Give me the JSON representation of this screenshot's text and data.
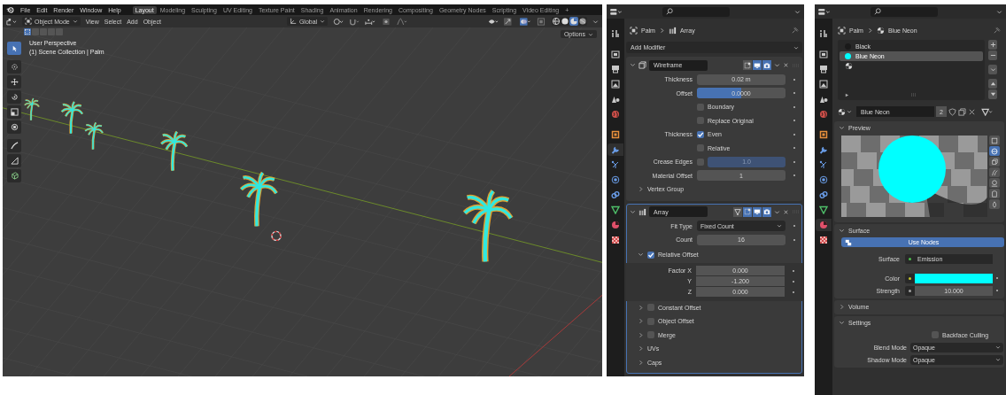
{
  "viewport": {
    "menu": [
      "File",
      "Edit",
      "Render",
      "Window",
      "Help"
    ],
    "workspaces": [
      {
        "label": "Layout",
        "selected": true
      },
      {
        "label": "Modeling",
        "selected": false
      },
      {
        "label": "Sculpting",
        "selected": false
      },
      {
        "label": "UV Editing",
        "selected": false
      },
      {
        "label": "Texture Paint",
        "selected": false
      },
      {
        "label": "Shading",
        "selected": false
      },
      {
        "label": "Animation",
        "selected": false
      },
      {
        "label": "Rendering",
        "selected": false
      },
      {
        "label": "Compositing",
        "selected": false
      },
      {
        "label": "Geometry Nodes",
        "selected": false
      },
      {
        "label": "Scripting",
        "selected": false
      },
      {
        "label": "Video Editing",
        "selected": false
      }
    ],
    "add_workspace": "+",
    "mode": "Object Mode",
    "header_menu": [
      "View",
      "Select",
      "Add",
      "Object"
    ],
    "orientation": "Global",
    "shading_modes": [
      {
        "kind": "wireframe",
        "selected": false
      },
      {
        "kind": "solid",
        "selected": false
      },
      {
        "kind": "material",
        "selected": true
      },
      {
        "kind": "rendered",
        "selected": false
      }
    ],
    "options": "Options",
    "overlay_text": [
      "User Perspective",
      "(1) Scene Collection | Palm"
    ],
    "tools": [
      {
        "selected": true
      },
      {
        "selected": false
      },
      {
        "selected": false
      },
      {
        "selected": false
      },
      {
        "selected": false
      },
      {
        "selected": false
      },
      {
        "selected": false
      },
      {
        "selected": false
      },
      {
        "selected": false
      }
    ]
  },
  "modifier_properties": {
    "tabs": [
      {
        "kind": "tool",
        "selected": false
      },
      {
        "kind": "render",
        "selected": false
      },
      {
        "kind": "output",
        "selected": false
      },
      {
        "kind": "view_layer",
        "selected": false
      },
      {
        "kind": "scene",
        "selected": false
      },
      {
        "kind": "world",
        "selected": false
      },
      {
        "kind": "object",
        "selected": false
      },
      {
        "kind": "modifiers",
        "selected": true
      },
      {
        "kind": "particles",
        "selected": false
      },
      {
        "kind": "physics",
        "selected": false
      },
      {
        "kind": "constraints",
        "selected": false
      },
      {
        "kind": "data",
        "selected": false
      },
      {
        "kind": "material",
        "selected": false
      },
      {
        "kind": "texture",
        "selected": false
      }
    ],
    "breadcrumb": [
      "Palm",
      "Array"
    ],
    "add_modifier": "Add Modifier",
    "modifiers": [
      {
        "kind": "wireframe",
        "name": "Wireframe",
        "expanded": true,
        "selected": false,
        "toggles": [
          {
            "kind": "edit_mode",
            "on": false
          },
          {
            "kind": "realtime",
            "on": true
          },
          {
            "kind": "render",
            "on": true
          }
        ],
        "rows": [
          {
            "kind": "field",
            "label": "Thickness",
            "value": "0.02 m"
          },
          {
            "kind": "slider",
            "label": "Offset",
            "value": "0.0000",
            "level": 0.5
          },
          {
            "kind": "check",
            "text": "Boundary",
            "checked": false
          },
          {
            "kind": "check",
            "text": "Replace Original",
            "checked": false
          },
          {
            "kind": "check",
            "label": "Thickness",
            "text": "Even",
            "checked": true
          },
          {
            "kind": "check",
            "text": "Relative",
            "checked": false
          },
          {
            "kind": "check_field",
            "label": "Crease Edges",
            "checked": false,
            "value": "1.0"
          },
          {
            "kind": "field",
            "label": "Material Offset",
            "value": "1"
          },
          {
            "kind": "subpanel",
            "text": "Vertex Group",
            "expanded": false
          }
        ]
      },
      {
        "kind": "array",
        "name": "Array",
        "expanded": true,
        "selected": true,
        "toggles": [
          {
            "kind": "on_cage",
            "on": false
          },
          {
            "kind": "edit_mode",
            "on": true
          },
          {
            "kind": "realtime",
            "on": true
          },
          {
            "kind": "render",
            "on": true
          }
        ],
        "rows": [
          {
            "kind": "dropdown",
            "label": "Fit Type",
            "value": "Fixed Count"
          },
          {
            "kind": "field",
            "label": "Count",
            "value": "16"
          },
          {
            "kind": "subpanel",
            "text": "Relative Offset",
            "expanded": true,
            "checked": true,
            "rows": [
              {
                "kind": "field",
                "label": "Factor X",
                "value": "0.000"
              },
              {
                "kind": "field",
                "label": "Y",
                "value": "-1.200"
              },
              {
                "kind": "field",
                "label": "Z",
                "value": "0.000"
              }
            ]
          },
          {
            "kind": "subpanel",
            "text": "Constant Offset",
            "expanded": false,
            "checked": false
          },
          {
            "kind": "subpanel",
            "text": "Object Offset",
            "expanded": false,
            "checked": false
          },
          {
            "kind": "subpanel",
            "text": "Merge",
            "expanded": false,
            "checked": false
          },
          {
            "kind": "subpanel",
            "text": "UVs",
            "expanded": false
          },
          {
            "kind": "subpanel",
            "text": "Caps",
            "expanded": false
          }
        ]
      }
    ]
  },
  "material_properties": {
    "tabs": [
      {
        "kind": "tool",
        "selected": false
      },
      {
        "kind": "render",
        "selected": false
      },
      {
        "kind": "output",
        "selected": false
      },
      {
        "kind": "view_layer",
        "selected": false
      },
      {
        "kind": "scene",
        "selected": false
      },
      {
        "kind": "world",
        "selected": false
      },
      {
        "kind": "object",
        "selected": false
      },
      {
        "kind": "modifiers",
        "selected": false
      },
      {
        "kind": "particles",
        "selected": false
      },
      {
        "kind": "physics",
        "selected": false
      },
      {
        "kind": "constraints",
        "selected": false
      },
      {
        "kind": "data",
        "selected": false
      },
      {
        "kind": "material",
        "selected": true
      },
      {
        "kind": "texture",
        "selected": false
      }
    ],
    "breadcrumb": [
      "Palm",
      "Blue Neon"
    ],
    "slots": [
      {
        "name": "Black",
        "color": "#1a1a1a",
        "selected": false
      },
      {
        "name": "Blue Neon",
        "color": "#00ffff",
        "selected": true
      }
    ],
    "material": {
      "name": "Blue Neon",
      "users": "2"
    },
    "preview": {
      "title": "Preview",
      "expanded": true,
      "shapes": [
        {
          "selected": false
        },
        {
          "selected": true
        },
        {
          "selected": false
        },
        {
          "selected": false
        },
        {
          "selected": false
        },
        {
          "selected": false
        },
        {
          "selected": false
        }
      ]
    },
    "surface": {
      "title": "Surface",
      "expanded": true,
      "use_nodes": "Use Nodes",
      "rows": [
        {
          "kind": "shader",
          "label": "Surface",
          "value": "Emission"
        },
        {
          "kind": "color",
          "label": "Color",
          "color": "#00ffff"
        },
        {
          "kind": "field",
          "label": "Strength",
          "value": "10.000"
        }
      ]
    },
    "volume": {
      "title": "Volume",
      "expanded": false
    },
    "settings": {
      "title": "Settings",
      "expanded": true,
      "rows": [
        {
          "kind": "check",
          "text": "Backface Culling",
          "checked": false
        },
        {
          "kind": "dropdown",
          "label": "Blend Mode",
          "value": "Opaque"
        },
        {
          "kind": "dropdown",
          "label": "Shadow Mode",
          "value": "Opaque"
        }
      ]
    }
  }
}
